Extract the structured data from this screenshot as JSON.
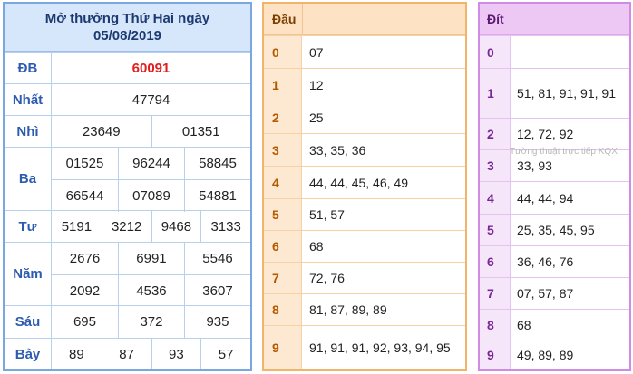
{
  "results": {
    "title_line1": "Mở thưởng Thứ Hai ngày",
    "title_line2": "05/08/2019",
    "prizes": {
      "db": {
        "label": "ĐB",
        "values": [
          "60091"
        ]
      },
      "nhat": {
        "label": "Nhất",
        "values": [
          "47794"
        ]
      },
      "nhi": {
        "label": "Nhì",
        "values": [
          "23649",
          "01351"
        ]
      },
      "ba": {
        "label": "Ba",
        "values": [
          "01525",
          "96244",
          "58845",
          "66544",
          "07089",
          "54881"
        ]
      },
      "tu": {
        "label": "Tư",
        "values": [
          "5191",
          "3212",
          "9468",
          "3133"
        ]
      },
      "nam": {
        "label": "Năm",
        "values": [
          "2676",
          "6991",
          "5546",
          "2092",
          "4536",
          "3607"
        ]
      },
      "sau": {
        "label": "Sáu",
        "values": [
          "695",
          "372",
          "935"
        ]
      },
      "bay": {
        "label": "Bảy",
        "values": [
          "89",
          "87",
          "93",
          "57"
        ]
      }
    }
  },
  "head_table": {
    "header": "Đầu",
    "rows": [
      {
        "key": "0",
        "value": "07"
      },
      {
        "key": "1",
        "value": "12"
      },
      {
        "key": "2",
        "value": "25"
      },
      {
        "key": "3",
        "value": "33, 35, 36"
      },
      {
        "key": "4",
        "value": "44, 44, 45, 46, 49"
      },
      {
        "key": "5",
        "value": "51, 57"
      },
      {
        "key": "6",
        "value": "68"
      },
      {
        "key": "7",
        "value": "72, 76"
      },
      {
        "key": "8",
        "value": "81, 87, 89, 89"
      },
      {
        "key": "9",
        "value": "91, 91, 91, 92, 93, 94, 95"
      }
    ]
  },
  "tail_table": {
    "header": "Đít",
    "rows": [
      {
        "key": "0",
        "value": ""
      },
      {
        "key": "1",
        "value": "51, 81, 91, 91, 91"
      },
      {
        "key": "2",
        "value": "12, 72, 92"
      },
      {
        "key": "3",
        "value": "33, 93"
      },
      {
        "key": "4",
        "value": "44, 44, 94"
      },
      {
        "key": "5",
        "value": "25, 35, 45, 95"
      },
      {
        "key": "6",
        "value": "36, 46, 76"
      },
      {
        "key": "7",
        "value": "07, 57, 87"
      },
      {
        "key": "8",
        "value": "68"
      },
      {
        "key": "9",
        "value": "49, 89, 89"
      }
    ]
  },
  "watermark": "Tường thuật trực tiếp KQX",
  "colors": {
    "special_prize": "#e11d1d",
    "results_border": "#7aa7df",
    "head_border": "#f2b36b",
    "tail_border": "#d08be6"
  }
}
